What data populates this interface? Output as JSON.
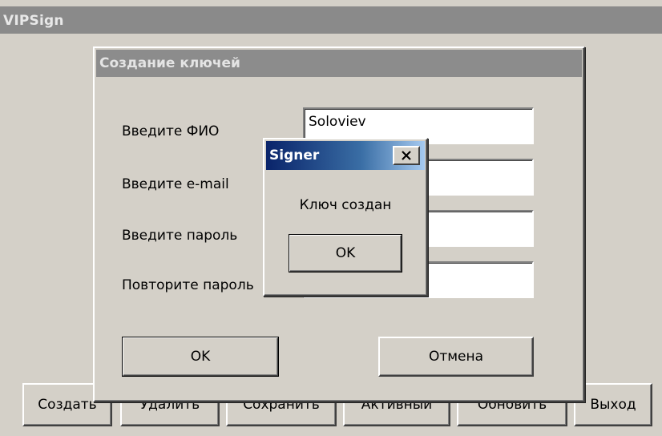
{
  "main_window": {
    "title": "VIPSign",
    "buttons": {
      "create": "Создать",
      "delete": "Удалить",
      "save": "Сохранить",
      "active": "Активный",
      "refresh": "Обновить",
      "exit": "Выход"
    }
  },
  "key_dialog": {
    "title": "Создание ключей",
    "fields": {
      "name_label": "Введите ФИО",
      "name_value": "Soloviev",
      "email_label": "Введите e-mail",
      "email_value": "",
      "password_label": "Введите пароль",
      "password_value": "",
      "repeat_label": "Повторите пароль",
      "repeat_value": ""
    },
    "ok_label": "OK",
    "cancel_label": "Отмена"
  },
  "message_box": {
    "title": "Signer",
    "message": "Ключ создан",
    "ok_label": "OK",
    "close_icon": "close-icon"
  }
}
